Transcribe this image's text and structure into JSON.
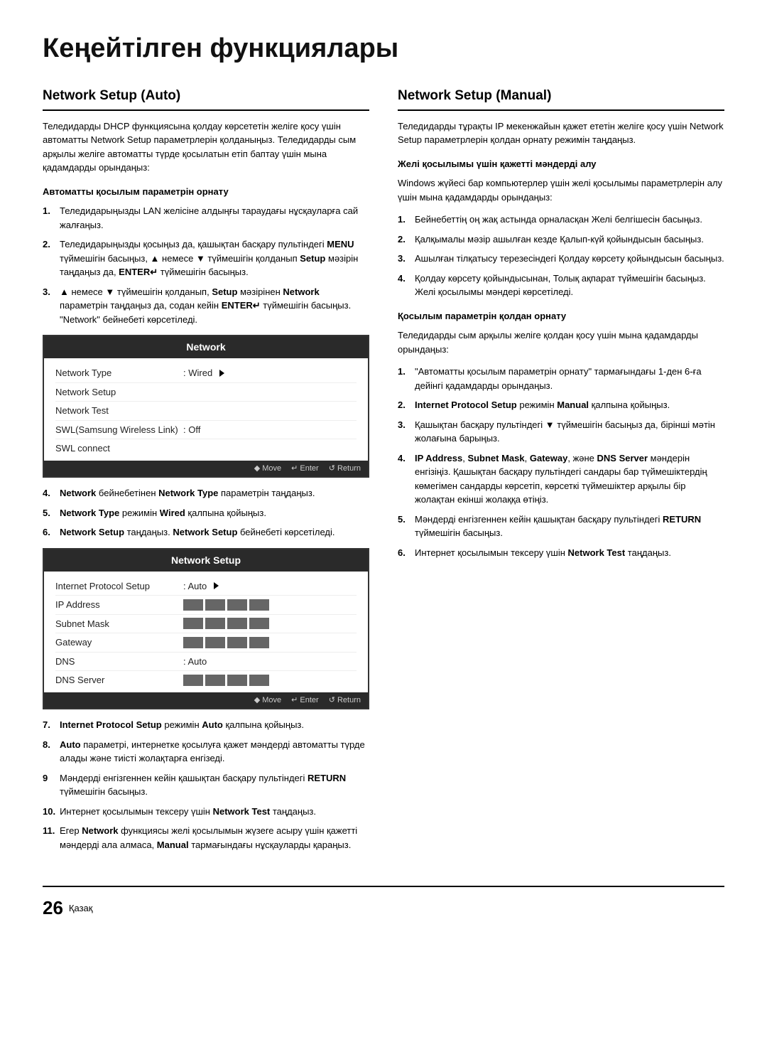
{
  "page": {
    "title": "Кеңейтілген функциялары",
    "number": "26",
    "lang": "Қазақ"
  },
  "left_column": {
    "section_title": "Network Setup (Auto)",
    "intro": "Теледидарды DHCP функциясына қолдау көрсететін желіге қосу үшін автоматты Network Setup параметрлерін қолданыңыз. Теледидарды сым арқылы желіге автоматты түрде қосылатын етіп баптау үшін мына қадамдарды орындаңыз:",
    "subsection1_title": "Автоматты қосылым параметрін орнату",
    "steps": [
      {
        "num": "1.",
        "text": "Теледидарыңызды LAN желісіне алдыңғы тараудағы нұсқауларға сай жалғаңыз."
      },
      {
        "num": "2.",
        "text": "Теледидарыңызды қосыңыз да, қашықтан басқару пультіндегі MENU түймешігін басыңыз, ▲ немесе ▼ түймешігін қолданып Setup мәзірін таңдаңыз да, ENTER↵ түймешігін басыңыз."
      },
      {
        "num": "3.",
        "text": "▲ немесе ▼ түймешігін қолданып, Setup мәзірінен Network параметрін таңдаңыз да, содан кейін ENTER↵ түймешігін басыңыз. \"Network\" бейнебеті көрсетіледі."
      }
    ],
    "network_box": {
      "title": "Network",
      "rows": [
        {
          "label": "Network Type",
          "value": ": Wired",
          "has_arrow": true
        },
        {
          "label": "Network Setup",
          "value": ""
        },
        {
          "label": "Network Test",
          "value": ""
        },
        {
          "label": "SWL(Samsung Wireless Link)",
          "value": ": Off"
        },
        {
          "label": "SWL connect",
          "value": ""
        }
      ],
      "footer": "◆ Move  ↵ Enter  ↺ Return"
    },
    "steps2": [
      {
        "num": "4.",
        "text": "Network бейнебетінен Network Type параметрін таңдаңыз."
      },
      {
        "num": "5.",
        "text": "Network Type режимін Wired қалпына қойыңыз."
      },
      {
        "num": "6.",
        "text": "Network Setup таңдаңыз. Network Setup бейнебеті көрсетіледі."
      }
    ],
    "network_setup_box": {
      "title": "Network Setup",
      "rows": [
        {
          "label": "Internet Protocol Setup",
          "value": ": Auto",
          "has_arrow": true,
          "masked": false
        },
        {
          "label": "IP Address",
          "value": "",
          "masked": true
        },
        {
          "label": "Subnet Mask",
          "value": "",
          "masked": true
        },
        {
          "label": "Gateway",
          "value": "",
          "masked": true
        },
        {
          "label": "DNS",
          "value": ": Auto",
          "masked": false
        },
        {
          "label": "DNS Server",
          "value": "",
          "masked": true
        }
      ],
      "footer": "◆ Move  ↵ Enter  ↺ Return"
    },
    "steps3": [
      {
        "num": "7.",
        "text": "Internet Protocol Setup режимін Auto қалпына қойыңыз."
      },
      {
        "num": "8.",
        "text": "Auto параметрі, интернетке қосылуға қажет мәндерді автоматты түрде алады және тиісті жолақтарға енгізеді."
      },
      {
        "num": "9",
        "text": "Мәндерді енгізгеннен кейін қашықтан басқару пультіндегі RETURN түймешігін басыңыз."
      },
      {
        "num": "10.",
        "text": "Интернет қосылымын тексеру үшін Network Test таңдаңыз."
      },
      {
        "num": "11.",
        "text": "Егер Network функциясы желі қосылымын жүзеге асыру үшін қажетті мәндерді ала алмаса, Manual тармағындағы нұсқауларды қараңыз."
      }
    ]
  },
  "right_column": {
    "section_title": "Network Setup (Manual)",
    "intro": "Теледидарды тұрақты IP мекенжайын қажет ететін желіге қосу үшін Network Setup параметрлерін қолдан орнату режимін таңдаңыз.",
    "subsection1_title": "Желі қосылымы үшін қажетті мәндерді алу",
    "intro2": "Windows жүйесі бар компьютерлер үшін желі қосылымы параметрлерін алу үшін мына қадамдарды орындаңыз:",
    "steps1": [
      {
        "num": "1.",
        "text": "Бейнебеттің оң жақ астында орналасқан Желі белгішесін басыңыз."
      },
      {
        "num": "2.",
        "text": "Қалқымалы мәзір ашылған кезде Қалып-күй қойындысын басыңыз."
      },
      {
        "num": "3.",
        "text": "Ашылған тілқатысу терезесіндегі Қолдау көрсету қойындысын басыңыз."
      },
      {
        "num": "4.",
        "text": "Қолдау көрсету қойындысынан, Толық ақпарат түймешігін басыңыз. Желі қосылымы мәндері көрсетіледі."
      }
    ],
    "subsection2_title": "Қосылым параметрін қолдан орнату",
    "intro3": "Теледидарды сым арқылы желіге қолдан қосу үшін мына қадамдарды орындаңыз:",
    "steps2": [
      {
        "num": "1.",
        "text": "\"Автоматты қосылым параметрін орнату\" тармағындағы 1-ден 6-ға дейінгі қадамдарды орындаңыз."
      },
      {
        "num": "2.",
        "text": "Internet Protocol Setup режимін Manual қалпына қойыңыз."
      },
      {
        "num": "3.",
        "text": "Қашықтан басқару пультіндегі ▼ түймешігін басыңыз да, бірінші мәтін жолағына барыңыз."
      },
      {
        "num": "4.",
        "text": "IP Address, Subnet Mask, Gateway, және DNS Server мәндерін енгізіңіз. Қашықтан басқару пультіндегі сандары бар түймешіктердің көмегімен сандарды көрсетіп, көрсеткі түймешіктер арқылы бір жолақтан екінші жолаққа өтіңіз."
      },
      {
        "num": "5.",
        "text": "Мәндерді енгізгеннен кейін қашықтан басқару пультіндегі RETURN түймешігін басыңыз."
      },
      {
        "num": "6.",
        "text": "Интернет қосылымын тексеру үшін Network Test таңдаңыз."
      }
    ]
  }
}
